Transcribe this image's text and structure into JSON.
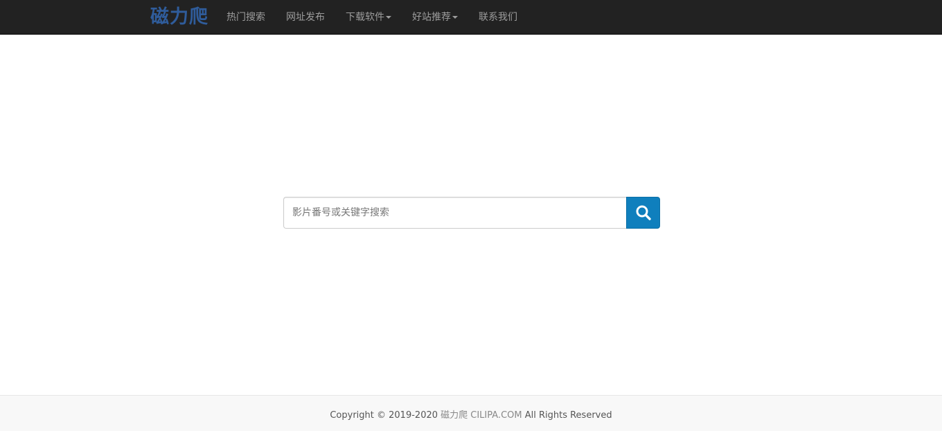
{
  "navbar": {
    "brand": "磁力爬",
    "items": [
      {
        "label": "热门搜索",
        "dropdown": false
      },
      {
        "label": "网址发布",
        "dropdown": false
      },
      {
        "label": "下载软件",
        "dropdown": true
      },
      {
        "label": "好站推荐",
        "dropdown": true
      },
      {
        "label": "联系我们",
        "dropdown": false
      }
    ]
  },
  "search": {
    "placeholder": "影片番号或关键字搜索",
    "value": "",
    "button_icon": "search-icon"
  },
  "footer": {
    "prefix": "Copyright © 2019-2020 ",
    "site_name": "磁力爬 CILIPA.COM",
    "suffix": " All Rights Reserved"
  },
  "colors": {
    "navbar_bg": "#222222",
    "brand": "#2f5c9b",
    "search_button": "#0f7fbd",
    "footer_bg": "#f8f8f8"
  }
}
